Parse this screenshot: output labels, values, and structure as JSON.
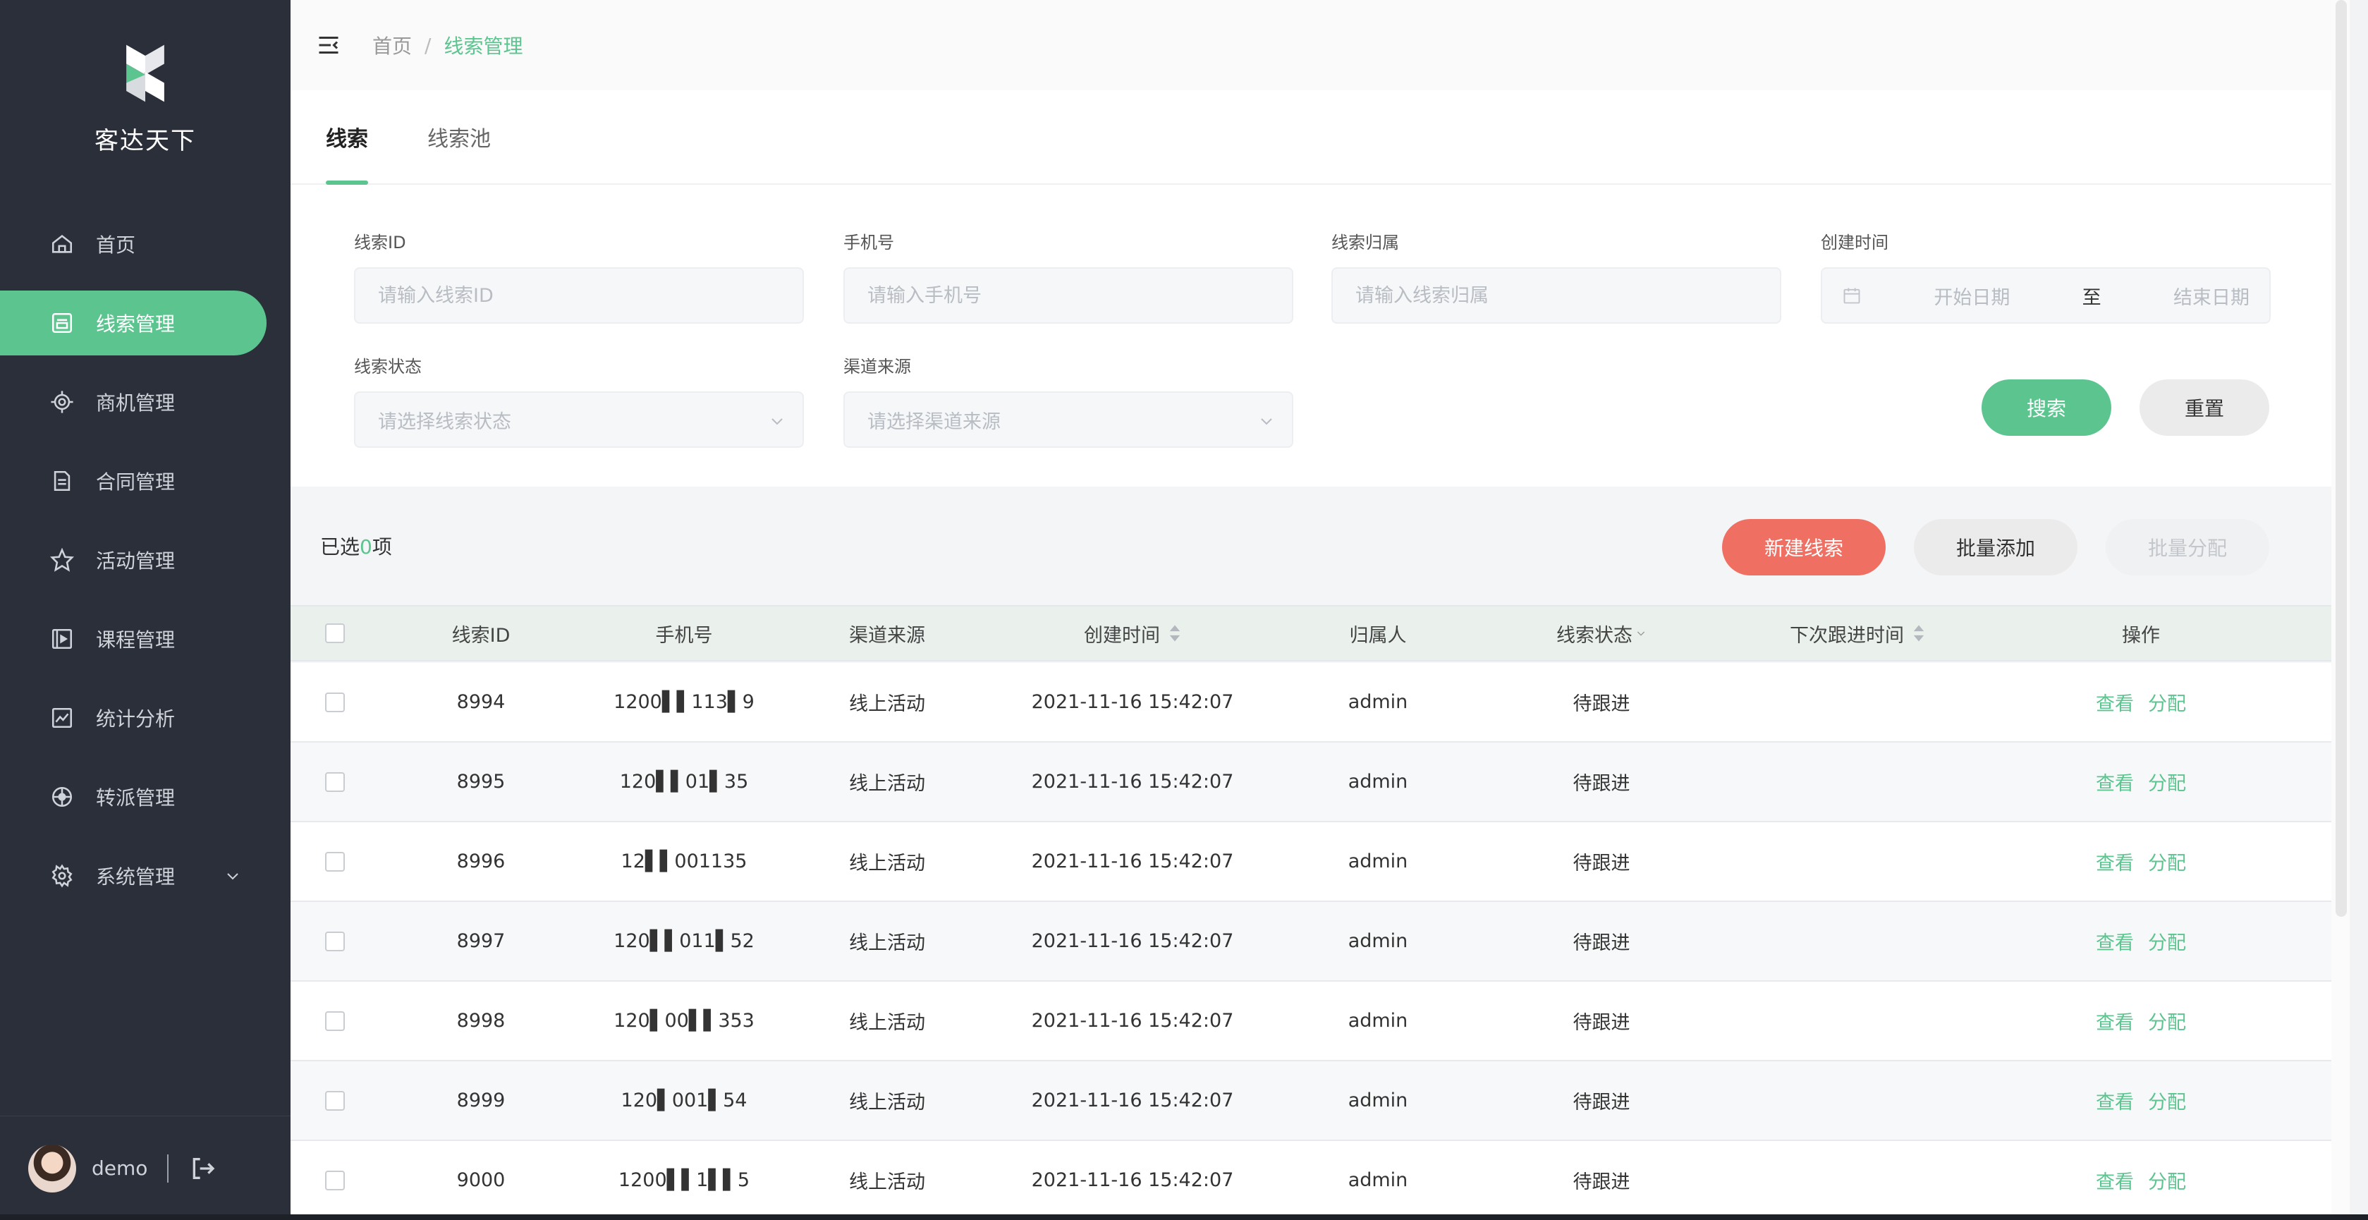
{
  "app": {
    "brand": "客达天下",
    "colors": {
      "accent": "#5cc58f",
      "danger": "#ef6f63",
      "sidebar": "#2b2f3a"
    }
  },
  "sidebar": {
    "items": [
      {
        "label": "首页",
        "icon": "home-icon",
        "active": false
      },
      {
        "label": "线索管理",
        "icon": "clue-icon",
        "active": true
      },
      {
        "label": "商机管理",
        "icon": "target-icon",
        "active": false
      },
      {
        "label": "合同管理",
        "icon": "document-icon",
        "active": false
      },
      {
        "label": "活动管理",
        "icon": "star-icon",
        "active": false
      },
      {
        "label": "课程管理",
        "icon": "video-icon",
        "active": false
      },
      {
        "label": "统计分析",
        "icon": "chart-icon",
        "active": false
      },
      {
        "label": "转派管理",
        "icon": "transfer-icon",
        "active": false
      },
      {
        "label": "系统管理",
        "icon": "gear-icon",
        "active": false
      }
    ],
    "user": {
      "name": "demo"
    }
  },
  "breadcrumb": {
    "home": "首页",
    "sep": "/",
    "current": "线索管理"
  },
  "tabs": [
    {
      "label": "线索"
    },
    {
      "label": "线索池"
    }
  ],
  "filters": {
    "clue_id": {
      "label": "线索ID",
      "placeholder": "请输入线索ID"
    },
    "phone": {
      "label": "手机号",
      "placeholder": "请输入手机号"
    },
    "owner": {
      "label": "线索归属",
      "placeholder": "请输入线索归属"
    },
    "created": {
      "label": "创建时间",
      "start": "开始日期",
      "to": "至",
      "end": "结束日期"
    },
    "status": {
      "label": "线索状态",
      "placeholder": "请选择线索状态"
    },
    "channel": {
      "label": "渠道来源",
      "placeholder": "请选择渠道来源"
    },
    "search_label": "搜索",
    "reset_label": "重置"
  },
  "list": {
    "selected_prefix": "已选",
    "selected_count": "0",
    "selected_suffix": "项",
    "new_label": "新建线索",
    "batch_add_label": "批量添加",
    "batch_assign_label": "批量分配",
    "columns": [
      "线索ID",
      "手机号",
      "渠道来源",
      "创建时间",
      "归属人",
      "线索状态",
      "下次跟进时间",
      "操作"
    ],
    "rows": [
      {
        "id": "8994",
        "phone": "1200▌▌113▌9",
        "channel": "线上活动",
        "created": "2021-11-16 15:42:07",
        "owner": "admin",
        "status": "待跟进",
        "next": "",
        "view": "查看",
        "assign": "分配"
      },
      {
        "id": "8995",
        "phone": "120▌▌01▌35",
        "channel": "线上活动",
        "created": "2021-11-16 15:42:07",
        "owner": "admin",
        "status": "待跟进",
        "next": "",
        "view": "查看",
        "assign": "分配"
      },
      {
        "id": "8996",
        "phone": "12▌▌001135",
        "channel": "线上活动",
        "created": "2021-11-16 15:42:07",
        "owner": "admin",
        "status": "待跟进",
        "next": "",
        "view": "查看",
        "assign": "分配"
      },
      {
        "id": "8997",
        "phone": "120▌▌011▌52",
        "channel": "线上活动",
        "created": "2021-11-16 15:42:07",
        "owner": "admin",
        "status": "待跟进",
        "next": "",
        "view": "查看",
        "assign": "分配"
      },
      {
        "id": "8998",
        "phone": "120▌00▌▌353",
        "channel": "线上活动",
        "created": "2021-11-16 15:42:07",
        "owner": "admin",
        "status": "待跟进",
        "next": "",
        "view": "查看",
        "assign": "分配"
      },
      {
        "id": "8999",
        "phone": "120▌001▌54",
        "channel": "线上活动",
        "created": "2021-11-16 15:42:07",
        "owner": "admin",
        "status": "待跟进",
        "next": "",
        "view": "查看",
        "assign": "分配"
      },
      {
        "id": "9000",
        "phone": "1200▌▌1▌▌5",
        "channel": "线上活动",
        "created": "2021-11-16 15:42:07",
        "owner": "admin",
        "status": "待跟进",
        "next": "",
        "view": "查看",
        "assign": "分配"
      }
    ]
  }
}
